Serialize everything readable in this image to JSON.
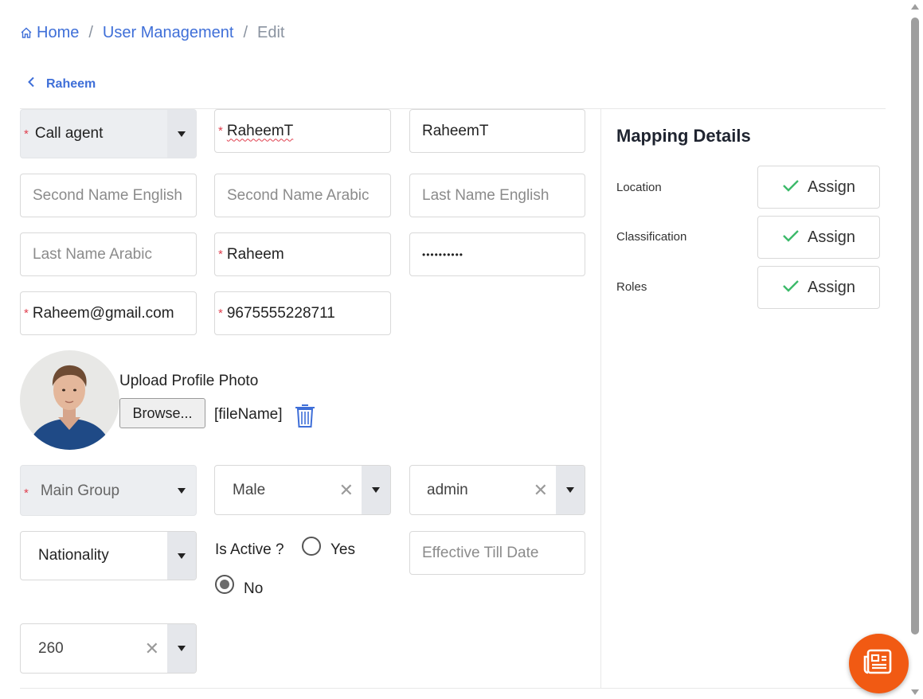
{
  "breadcrumb": {
    "home": "Home",
    "section": "User Management",
    "current": "Edit"
  },
  "back_label": "Raheem",
  "form": {
    "user_type": "Call agent",
    "first_name_en": "RaheemT",
    "first_name_ar": "RaheemT",
    "second_name_en_ph": "Second Name English",
    "second_name_ar_ph": "Second Name Arabic",
    "last_name_en_ph": "Last Name English",
    "last_name_ar_ph": "Last Name Arabic",
    "username": "Raheem",
    "password_mask": "••••••••••",
    "email": "Raheem@gmail.com",
    "phone": "9675555228711",
    "upload_label": "Upload Profile Photo",
    "browse_label": "Browse...",
    "file_name": "[fileName]",
    "main_group_ph": "Main Group",
    "gender": "Male",
    "role_select": "admin",
    "nationality": "Nationality",
    "is_active_label": "Is Active ?",
    "yes_label": "Yes",
    "no_label": "No",
    "effective_till_ph": "Effective Till Date",
    "extra_select": "260"
  },
  "mapping": {
    "title": "Mapping Details",
    "rows": [
      {
        "label": "Location",
        "button": "Assign"
      },
      {
        "label": "Classification",
        "button": "Assign"
      },
      {
        "label": "Roles",
        "button": "Assign"
      }
    ]
  },
  "colors": {
    "link": "#3f6fd8",
    "required": "#e0404f",
    "check": "#3cba6a",
    "fab": "#f15a13"
  },
  "icons": [
    "home-icon",
    "chevron-left-icon",
    "trash-icon",
    "check-icon",
    "news-icon"
  ]
}
